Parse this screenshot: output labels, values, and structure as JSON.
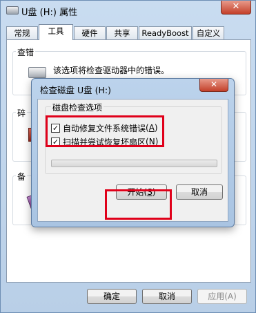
{
  "window": {
    "title": "U盘 (H:) 属性",
    "close_label": "✕"
  },
  "tabs": [
    {
      "label": "常规"
    },
    {
      "label": "工具"
    },
    {
      "label": "硬件"
    },
    {
      "label": "共享"
    },
    {
      "label": "ReadyBoost"
    },
    {
      "label": "自定义"
    }
  ],
  "active_tab": "工具",
  "error_check": {
    "title": "查错",
    "description": "该选项将检查驱动器中的错误。"
  },
  "defrag": {
    "title_partial": "碎"
  },
  "backup": {
    "title_partial": "备"
  },
  "bottom_buttons": {
    "ok": "确定",
    "cancel": "取消",
    "apply": "应用(A)"
  },
  "dialog": {
    "title": "检查磁盘 U盘 (H:)",
    "close_label": "✕",
    "group_title": "磁盘检查选项",
    "option1": {
      "label": "自动修复文件系统错误",
      "accel": "A",
      "checked": true
    },
    "option2": {
      "label": "扫描并尝试恢复坏扇区",
      "accel": "N",
      "checked": true
    },
    "progress": 0,
    "start_label": "开始",
    "start_accel": "S",
    "cancel_label": "取消"
  },
  "colors": {
    "highlight": "#e0001a",
    "progress_green": "#26b13c"
  }
}
